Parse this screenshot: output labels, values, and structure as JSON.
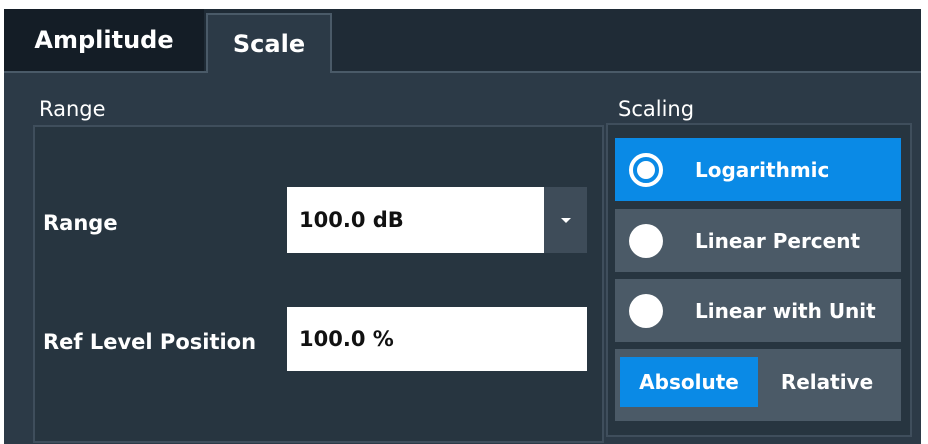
{
  "tabs": [
    {
      "label": "Amplitude",
      "active": false
    },
    {
      "label": "Scale",
      "active": true
    }
  ],
  "range_group": {
    "title": "Range",
    "range_label": "Range",
    "range_value": "100.0 dB",
    "ref_level_label": "Ref Level Position",
    "ref_level_value": "100.0 %"
  },
  "scaling_group": {
    "title": "Scaling",
    "options": [
      {
        "label": "Logarithmic",
        "selected": true
      },
      {
        "label": "Linear Percent",
        "selected": false
      },
      {
        "label": "Linear with Unit",
        "selected": false
      }
    ],
    "mode_toggle": {
      "options": [
        "Absolute",
        "Relative"
      ],
      "selected": "Absolute"
    }
  },
  "colors": {
    "panel": "#2c3a47",
    "accent": "#0a8ae6",
    "input_bg": "#ffffff"
  }
}
